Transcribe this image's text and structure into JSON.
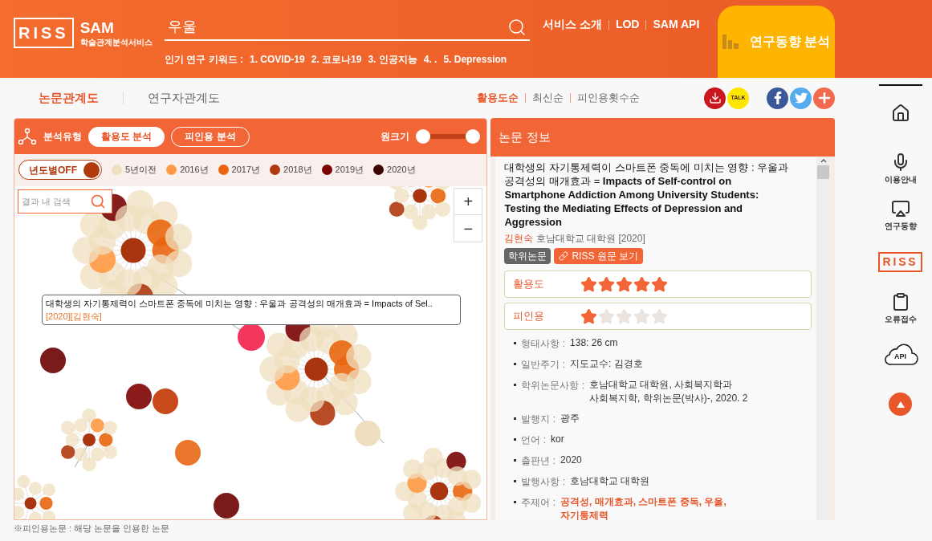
{
  "header": {
    "logo": {
      "mark": "RISS",
      "name": "SAM",
      "subtitle": "학술관계분석서비스"
    },
    "search": {
      "value": "우울"
    },
    "keywords_label": "인기 연구 키워드 :",
    "keywords": [
      "1. COVID-19",
      "2. 코로나19",
      "3. 인공지능",
      "4. .",
      "5. Depression"
    ],
    "nav": [
      "서비스 소개",
      "LOD",
      "SAM API"
    ],
    "trend_tab": "연구동향 분석"
  },
  "view_tabs": [
    {
      "label": "논문관계도",
      "selected": true
    },
    {
      "label": "연구자관계도",
      "selected": false
    }
  ],
  "sort_options": [
    {
      "label": "활용도순",
      "selected": true
    },
    {
      "label": "최신순",
      "selected": false
    },
    {
      "label": "피인용횟수순",
      "selected": false
    }
  ],
  "share": {
    "kakao_label": "TALK"
  },
  "graph_panel": {
    "analysis_label": "분석유형",
    "analysis_types": [
      {
        "label": "활용도 분석",
        "selected": true
      },
      {
        "label": "피인용 분석",
        "selected": false
      }
    ],
    "size_label": "원크기",
    "size_slider": {
      "level": 1
    },
    "year_toggle": {
      "label": "년도별OFF",
      "on": false
    },
    "legend": [
      {
        "label": "5년이전",
        "color": "#efdfbf"
      },
      {
        "label": "2016년",
        "color": "#ff9a45"
      },
      {
        "label": "2017년",
        "color": "#e9660e"
      },
      {
        "label": "2018년",
        "color": "#b0390e"
      },
      {
        "label": "2019년",
        "color": "#7a0505"
      },
      {
        "label": "2020년",
        "color": "#3f0505"
      }
    ],
    "search_placeholder": "결과 내 검색",
    "zoom_in": "+",
    "zoom_out": "−",
    "tooltip": {
      "title": "대학생의 자기통제력이 스마트폰 중독에 미치는 영향 : 우울과 공격성의 매개효과 = Impacts of Sel..",
      "meta": "[2020][김현숙]"
    }
  },
  "footnote": "※피인용논문 : 해당 논문을 인용한 논문",
  "info_panel": {
    "title": "논문 정보",
    "paper_title": "대학생의 자기통제력이 스마트폰 중독에 미치는 영향 : 우울과 공격성의 매개효과 = **Impacts of Self-control on Smartphone Addiction Among University Students: Testing the Mediating Effects of Depression and Aggression**",
    "author": "김현숙",
    "affiliation": "호남대학교 대학원 [2020]",
    "type_badge": "학위논문",
    "riss_link": "RISS 원문 보기",
    "ratings": [
      {
        "label": "활용도",
        "stars": 5
      },
      {
        "label": "피인용",
        "stars": 1
      }
    ],
    "details": [
      {
        "label": "형태사항 :",
        "value": "138: 26 cm",
        "kind": "text"
      },
      {
        "label": "일반주기 :",
        "value": "지도교수: 김경호",
        "kind": "text"
      },
      {
        "label": "학위논문사항 :",
        "value": "호남대학교 대학원, 사회복지학과\n사회복지학, 학위논문(박사)-, 2020. 2",
        "kind": "text"
      },
      {
        "label": "발행지 :",
        "value": "광주",
        "kind": "text"
      },
      {
        "label": "언어 :",
        "value": "kor",
        "kind": "text"
      },
      {
        "label": "출판년 :",
        "value": "2020",
        "kind": "text"
      },
      {
        "label": "발행사항 :",
        "value": "호남대학교 대학원",
        "kind": "text"
      },
      {
        "label": "주제어 :",
        "value": "공격성, 매개효과, 스마트폰 중독, 우울,\n자기통제력",
        "kind": "keywords"
      }
    ]
  },
  "sidebar": [
    {
      "kind": "home"
    },
    {
      "kind": "mic",
      "label": "이용안내"
    },
    {
      "kind": "screen",
      "label": "연구동향"
    },
    {
      "kind": "logo",
      "label": "RISS"
    },
    {
      "kind": "clipboard",
      "label": "오류접수"
    },
    {
      "kind": "cloud",
      "label": "API"
    }
  ]
}
